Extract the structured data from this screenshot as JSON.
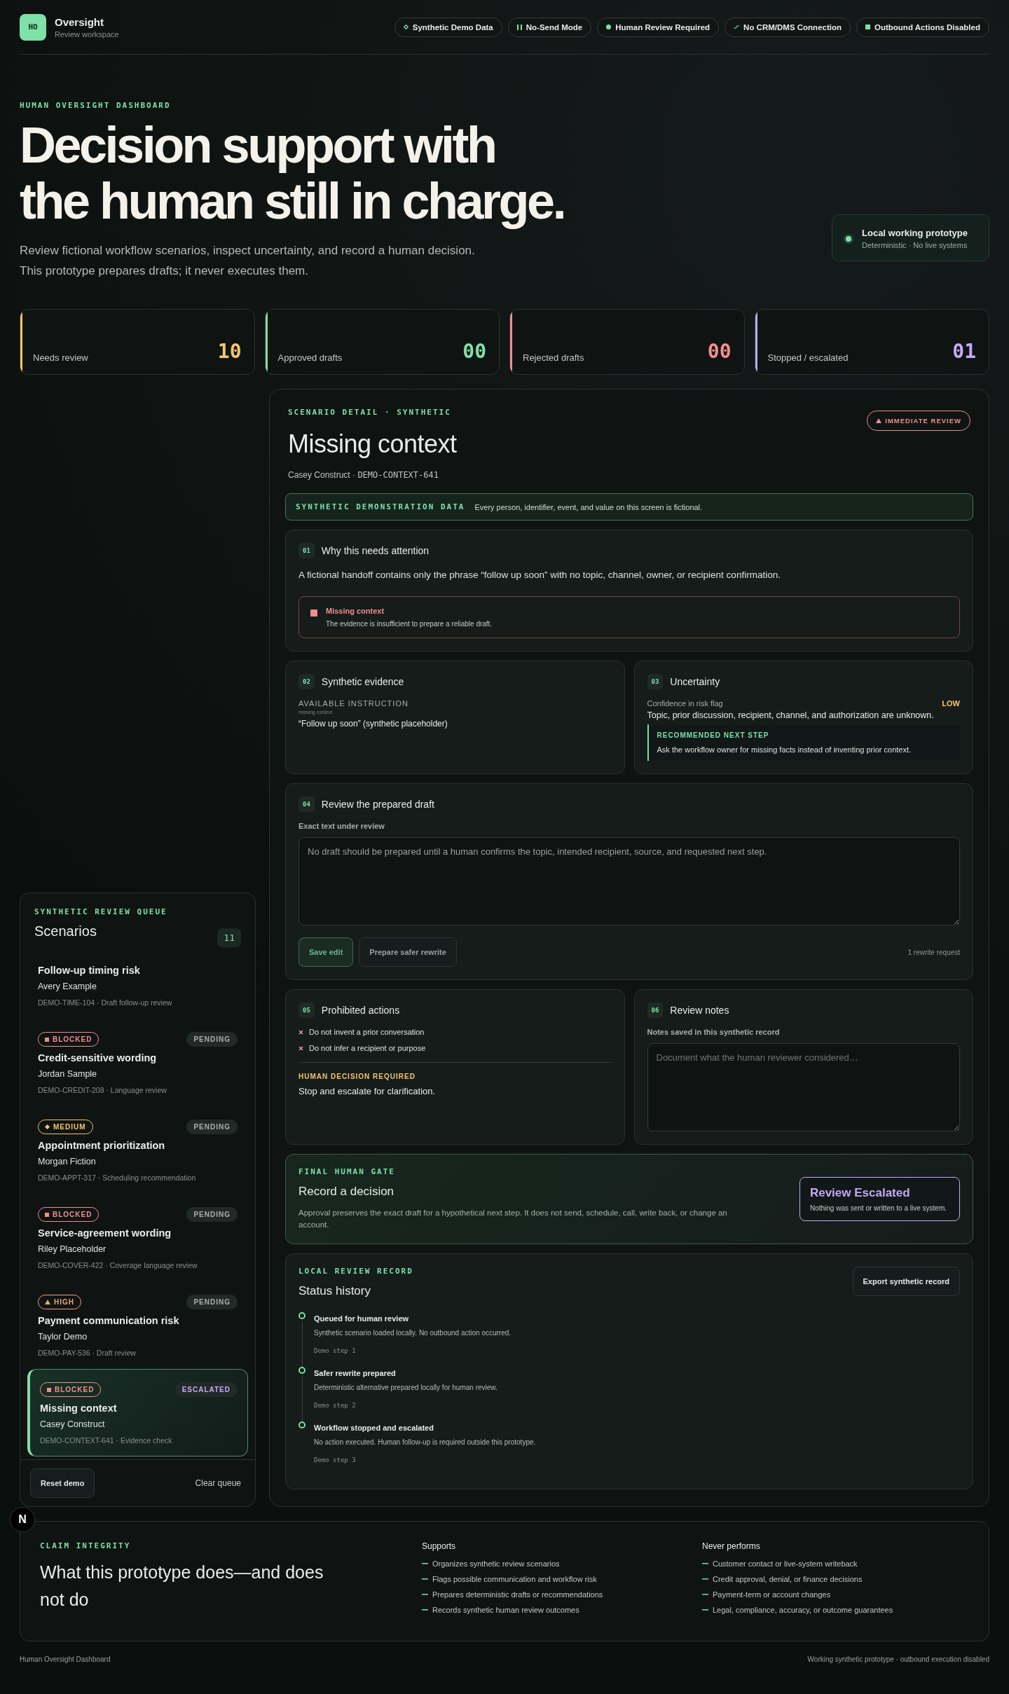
{
  "header": {
    "logo": "HO",
    "title": "Oversight",
    "subtitle": "Review workspace",
    "pills": [
      {
        "kind": "diamond",
        "label": "Synthetic Demo Data"
      },
      {
        "kind": "pause",
        "label": "No-Send Mode"
      },
      {
        "kind": "dot",
        "label": "Human Review Required"
      },
      {
        "kind": "link",
        "label": "No CRM/DMS Connection"
      },
      {
        "kind": "square",
        "label": "Outbound Actions Disabled"
      }
    ]
  },
  "hero": {
    "eyebrow": "HUMAN OVERSIGHT DASHBOARD",
    "title_lines": [
      "Decision support with",
      "the human still in charge."
    ],
    "lines": [
      "Review fictional workflow scenarios, inspect uncertainty, and record a human decision.",
      "This prototype prepares drafts; it never executes them."
    ],
    "status_card": {
      "title": "Local working prototype",
      "subtitle": "Deterministic · No live systems"
    }
  },
  "stats": [
    {
      "label": "Needs review",
      "value": "10",
      "color": "#f5c56b"
    },
    {
      "label": "Approved drafts",
      "value": "00",
      "color": "#7fe0a8"
    },
    {
      "label": "Rejected drafts",
      "value": "00",
      "color": "#f08f8f"
    },
    {
      "label": "Stopped / escalated",
      "value": "01",
      "color": "#c3a8f7"
    }
  ],
  "queue": {
    "eyebrow": "SYNTHETIC REVIEW QUEUE",
    "title": "Scenarios",
    "count": "11",
    "items": [
      {
        "title": "Follow-up timing risk",
        "person": "Avery Example",
        "meta": "DEMO-TIME-104 · Draft follow-up review",
        "selected": false
      },
      {
        "tier": {
          "kind": "square",
          "label": "BLOCKED"
        },
        "status": {
          "kind": "muted",
          "label": "PENDING"
        },
        "title": "Credit-sensitive wording",
        "person": "Jordan Sample",
        "meta": "DEMO-CREDIT-208 · Language review",
        "selected": false
      },
      {
        "tier": {
          "kind": "diamond",
          "label": "MEDIUM"
        },
        "status": {
          "kind": "muted",
          "label": "PENDING"
        },
        "title": "Appointment prioritization",
        "person": "Morgan Fiction",
        "meta": "DEMO-APPT-317 · Scheduling recommendation",
        "selected": false
      },
      {
        "tier": {
          "kind": "square",
          "label": "BLOCKED"
        },
        "status": {
          "kind": "muted",
          "label": "PENDING"
        },
        "title": "Service-agreement wording",
        "person": "Riley Placeholder",
        "meta": "DEMO-COVER-422 · Coverage language review",
        "selected": false
      },
      {
        "tier": {
          "kind": "triangle",
          "label": "HIGH"
        },
        "status": {
          "kind": "muted",
          "label": "PENDING"
        },
        "title": "Payment communication risk",
        "person": "Taylor Demo",
        "meta": "DEMO-PAY-536 · Draft review",
        "selected": false
      },
      {
        "tier": {
          "kind": "square",
          "label": "BLOCKED"
        },
        "status": {
          "kind": "accent",
          "label": "ESCALATED"
        },
        "title": "Missing context",
        "person": "Casey Construct",
        "meta": "DEMO-CONTEXT-641 · Evidence check",
        "selected": true
      }
    ],
    "buttons": [
      "Reset demo",
      "Clear queue"
    ]
  },
  "dev_indicator": "N",
  "detail": {
    "eyebrow": "SCENARIO DETAIL · SYNTHETIC",
    "badge": "IMMEDIATE REVIEW",
    "title": "Missing context",
    "person": "Casey Construct · ",
    "ref": "DEMO-CONTEXT-641",
    "notice": {
      "label": "SYNTHETIC DEMONSTRATION DATA",
      "text": "Every person, identifier, event, and value on this screen is fictional."
    },
    "attention": {
      "num": "01",
      "title": "Why this needs attention",
      "text": "A fictional handoff contains only the phrase “follow up soon” with no topic, channel, owner, or recipient confirmation.",
      "alert_title": "Missing context",
      "alert_text": "The evidence is insufficient to prepare a reliable draft."
    },
    "evidence": {
      "num": "02",
      "title": "Synthetic evidence",
      "label": "AVAILABLE INSTRUCTION",
      "sublabel": "missing context",
      "quote": "“Follow up soon” (synthetic placeholder)"
    },
    "uncertainty": {
      "num": "03",
      "title": "Uncertainty",
      "label": "Confidence in risk flag",
      "level_text": "LOW",
      "text": "Topic, prior discussion, recipient, channel, and authorization are unknown.",
      "next_label": "RECOMMENDED NEXT STEP",
      "next_text": "Ask the workflow owner for missing facts instead of inventing prior context."
    },
    "draft": {
      "num": "04",
      "title": "Review the prepared draft",
      "label": "Exact text under review",
      "value": "No draft should be prepared until a human confirms the topic, intended recipient, source, and requested next step.",
      "buttons": [
        "Save edit",
        "Prepare safer rewrite"
      ],
      "note": "1 rewrite request"
    },
    "prohibited": {
      "num": "05",
      "title": "Prohibited actions",
      "items": [
        "Do not invent a prior conversation",
        "Do not infer a recipient or purpose"
      ],
      "decision_label": "HUMAN DECISION REQUIRED",
      "decision": "Stop and escalate for clarification."
    },
    "notes": {
      "num": "06",
      "title": "Review notes",
      "label": "Notes saved in this synthetic record",
      "placeholder": "Document what the human reviewer considered…"
    },
    "gate": {
      "eyebrow": "FINAL HUMAN GATE",
      "title": "Record a decision",
      "text": "Approval preserves the exact draft for a hypothetical next step. It does not send, schedule, call, write back, or change an account.",
      "result_title": "Review Escalated",
      "result_text": "Nothing was sent or written to a live system."
    },
    "record": {
      "eyebrow": "LOCAL REVIEW RECORD",
      "title": "Status history",
      "button": "Export synthetic record",
      "steps": [
        {
          "title": "Queued for human review",
          "text": "Synthetic scenario loaded locally. No outbound action occurred.",
          "step": "Demo step 1"
        },
        {
          "title": "Safer rewrite prepared",
          "text": "Deterministic alternative prepared locally for human review.",
          "step": "Demo step 2"
        },
        {
          "title": "Workflow stopped and escalated",
          "text": "No action executed. Human follow-up is required outside this prototype.",
          "step": "Demo step 3"
        }
      ]
    }
  },
  "claims": {
    "eyebrow": "CLAIM INTEGRITY",
    "title": "What this prototype does—and does not do",
    "columns": [
      {
        "title": "Supports",
        "items": [
          "Organizes synthetic review scenarios",
          "Flags possible communication and workflow risk",
          "Prepares deterministic drafts or recommendations",
          "Records synthetic human review outcomes"
        ]
      },
      {
        "title": "Never performs",
        "items": [
          "Customer contact or live-system writeback",
          "Credit approval, denial, or finance decisions",
          "Payment-term or account changes",
          "Legal, compliance, accuracy, or outcome guarantees"
        ]
      }
    ]
  },
  "footer": {
    "left": "Human Oversight Dashboard",
    "right": "Working synthetic prototype · outbound execution disabled"
  }
}
